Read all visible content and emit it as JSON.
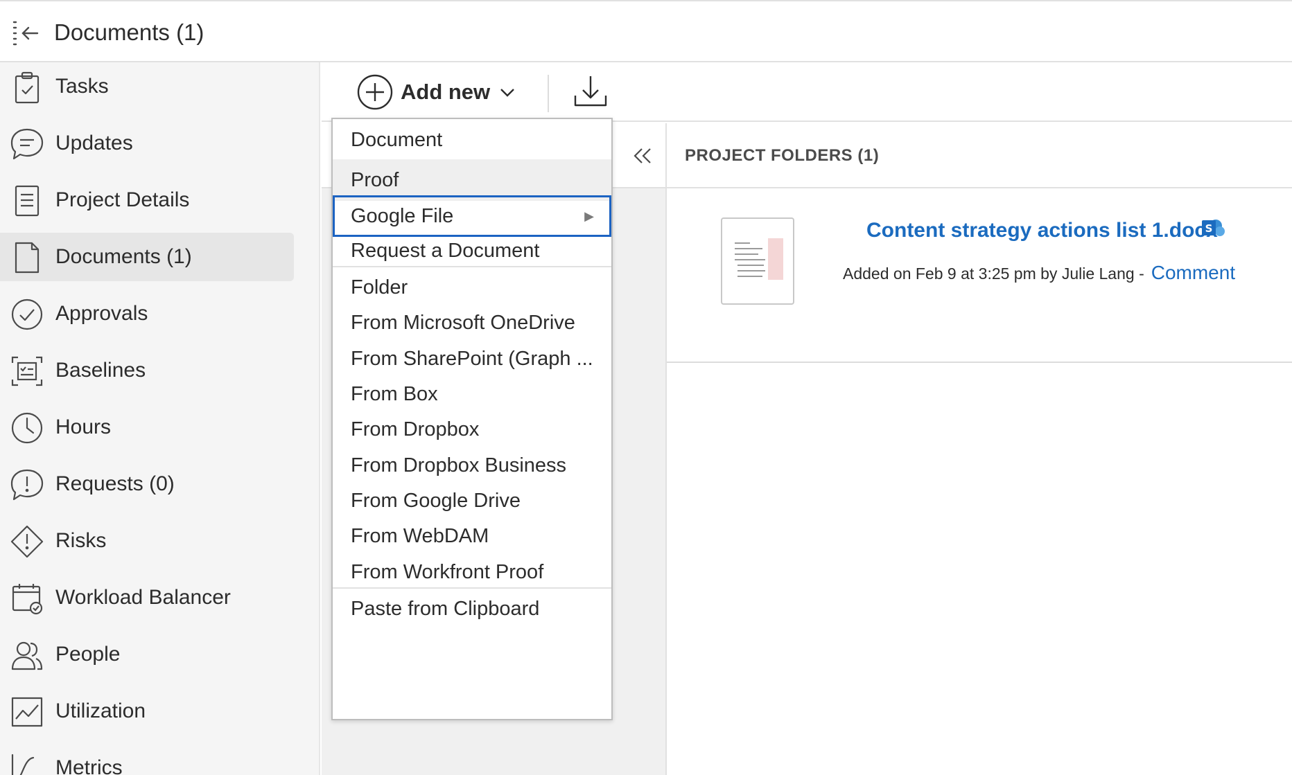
{
  "header": {
    "title": "Documents (1)",
    "collapse_icon": "collapse-sidebar-icon"
  },
  "sidebar": {
    "items": [
      {
        "label": "Tasks",
        "icon": "clipboard-check-icon"
      },
      {
        "label": "Updates",
        "icon": "chat-bubble-icon"
      },
      {
        "label": "Project Details",
        "icon": "document-lines-icon"
      },
      {
        "label": "Documents (1)",
        "icon": "document-icon",
        "active": true
      },
      {
        "label": "Approvals",
        "icon": "check-circle-icon"
      },
      {
        "label": "Baselines",
        "icon": "baseline-icon"
      },
      {
        "label": "Hours",
        "icon": "clock-icon"
      },
      {
        "label": "Requests (0)",
        "icon": "request-alert-icon"
      },
      {
        "label": "Risks",
        "icon": "risk-diamond-icon"
      },
      {
        "label": "Workload Balancer",
        "icon": "calendar-check-icon"
      },
      {
        "label": "People",
        "icon": "people-icon"
      },
      {
        "label": "Utilization",
        "icon": "line-chart-icon"
      },
      {
        "label": "Metrics",
        "icon": "curve-chart-icon"
      }
    ]
  },
  "toolbar": {
    "add_new_label": "Add new",
    "download_icon": "download-icon"
  },
  "menu": {
    "items": [
      {
        "label": "Document"
      },
      {
        "label": "Proof",
        "state": "hover"
      },
      {
        "label": "Google File",
        "state": "focused",
        "submenu": true
      },
      {
        "label": "Request a Document"
      },
      {
        "label": "Folder"
      },
      {
        "label": "From Microsoft OneDrive"
      },
      {
        "label": "From SharePoint (Graph ..."
      },
      {
        "label": "From Box"
      },
      {
        "label": "From Dropbox"
      },
      {
        "label": "From Dropbox Business"
      },
      {
        "label": "From Google Drive"
      },
      {
        "label": "From WebDAM"
      },
      {
        "label": "From Workfront Proof"
      },
      {
        "label": "Paste from Clipboard"
      }
    ],
    "submenu_arrow": "▶"
  },
  "folders": {
    "header": "PROJECT FOLDERS (1)"
  },
  "document": {
    "name": "Content strategy actions list 1.docx",
    "meta": "Added on Feb 9 at 3:25 pm by Julie Lang -",
    "comment_label": "Comment",
    "link_color": "#1b6bbf"
  },
  "colors": {
    "accent": "#1c63c2",
    "link": "#1b6bbf",
    "sidebar_bg": "#f5f5f5"
  }
}
